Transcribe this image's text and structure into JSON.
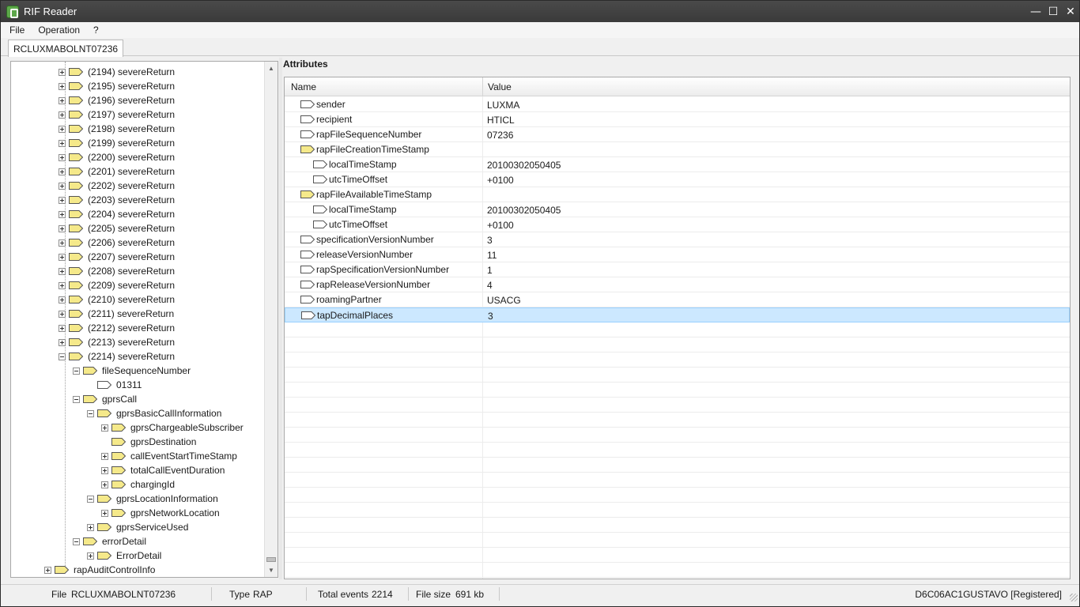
{
  "window": {
    "title": "RIF Reader",
    "controls": [
      "—",
      "☐",
      "✕"
    ]
  },
  "menu": {
    "items": [
      "File",
      "Operation",
      "?"
    ]
  },
  "tab": {
    "label": "RCLUXMABOLNT07236"
  },
  "tree": {
    "collapsed_items": [
      {
        "label": "(2194) severeReturn"
      },
      {
        "label": "(2195) severeReturn"
      },
      {
        "label": "(2196) severeReturn"
      },
      {
        "label": "(2197) severeReturn"
      },
      {
        "label": "(2198) severeReturn"
      },
      {
        "label": "(2199) severeReturn"
      },
      {
        "label": "(2200) severeReturn"
      },
      {
        "label": "(2201) severeReturn"
      },
      {
        "label": "(2202) severeReturn"
      },
      {
        "label": "(2203) severeReturn"
      },
      {
        "label": "(2204) severeReturn"
      },
      {
        "label": "(2205) severeReturn"
      },
      {
        "label": "(2206) severeReturn"
      },
      {
        "label": "(2207) severeReturn"
      },
      {
        "label": "(2208) severeReturn"
      },
      {
        "label": "(2209) severeReturn"
      },
      {
        "label": "(2210) severeReturn"
      },
      {
        "label": "(2211) severeReturn"
      },
      {
        "label": "(2212) severeReturn"
      },
      {
        "label": "(2213) severeReturn"
      }
    ],
    "expanded": {
      "root": "(2214) severeReturn",
      "fileSequenceNumber": "fileSequenceNumber",
      "fileSequenceValue": "01311",
      "gprsCall": "gprsCall",
      "gprsBasicCallInformation": "gprsBasicCallInformation",
      "gprsChargeableSubscriber": "gprsChargeableSubscriber",
      "gprsDestination": "gprsDestination",
      "callEventStartTimeStamp": "callEventStartTimeStamp",
      "totalCallEventDuration": "totalCallEventDuration",
      "chargingId": "chargingId",
      "gprsLocationInformation": "gprsLocationInformation",
      "gprsNetworkLocation": "gprsNetworkLocation",
      "gprsServiceUsed": "gprsServiceUsed",
      "errorDetail": "errorDetail",
      "ErrorDetail": "ErrorDetail",
      "rapAuditControlInfo": "rapAuditControlInfo"
    }
  },
  "attributes": {
    "title": "Attributes",
    "columns": {
      "name": "Name",
      "value": "Value"
    },
    "rows": [
      {
        "name": "sender",
        "value": "LUXMA",
        "level": 0,
        "folder": false
      },
      {
        "name": "recipient",
        "value": "HTICL",
        "level": 0,
        "folder": false
      },
      {
        "name": "rapFileSequenceNumber",
        "value": "07236",
        "level": 0,
        "folder": false
      },
      {
        "name": "rapFileCreationTimeStamp",
        "value": "",
        "level": 0,
        "folder": true
      },
      {
        "name": "localTimeStamp",
        "value": "20100302050405",
        "level": 1,
        "folder": false
      },
      {
        "name": "utcTimeOffset",
        "value": "+0100",
        "level": 1,
        "folder": false
      },
      {
        "name": "rapFileAvailableTimeStamp",
        "value": "",
        "level": 0,
        "folder": true
      },
      {
        "name": "localTimeStamp",
        "value": "20100302050405",
        "level": 1,
        "folder": false
      },
      {
        "name": "utcTimeOffset",
        "value": "+0100",
        "level": 1,
        "folder": false
      },
      {
        "name": "specificationVersionNumber",
        "value": "3",
        "level": 0,
        "folder": false
      },
      {
        "name": "releaseVersionNumber",
        "value": "11",
        "level": 0,
        "folder": false
      },
      {
        "name": "rapSpecificationVersionNumber",
        "value": "1",
        "level": 0,
        "folder": false
      },
      {
        "name": "rapReleaseVersionNumber",
        "value": "4",
        "level": 0,
        "folder": false
      },
      {
        "name": "roamingPartner",
        "value": "USACG",
        "level": 0,
        "folder": false
      },
      {
        "name": "tapDecimalPlaces",
        "value": "3",
        "level": 0,
        "folder": false,
        "selected": true
      }
    ]
  },
  "status": {
    "file_label": "File",
    "file_value": "RCLUXMABOLNT07236",
    "type_label": "Type",
    "type_value": "RAP",
    "events_label": "Total events",
    "events_value": "2214",
    "size_label": "File size",
    "size_value": "691 kb",
    "registration": "D6C06AC1GUSTAVO [Registered]"
  },
  "colors": {
    "titlebar": "#3f3f3f",
    "folder_fill": "#f5e98a",
    "selection": "#cce8ff"
  }
}
